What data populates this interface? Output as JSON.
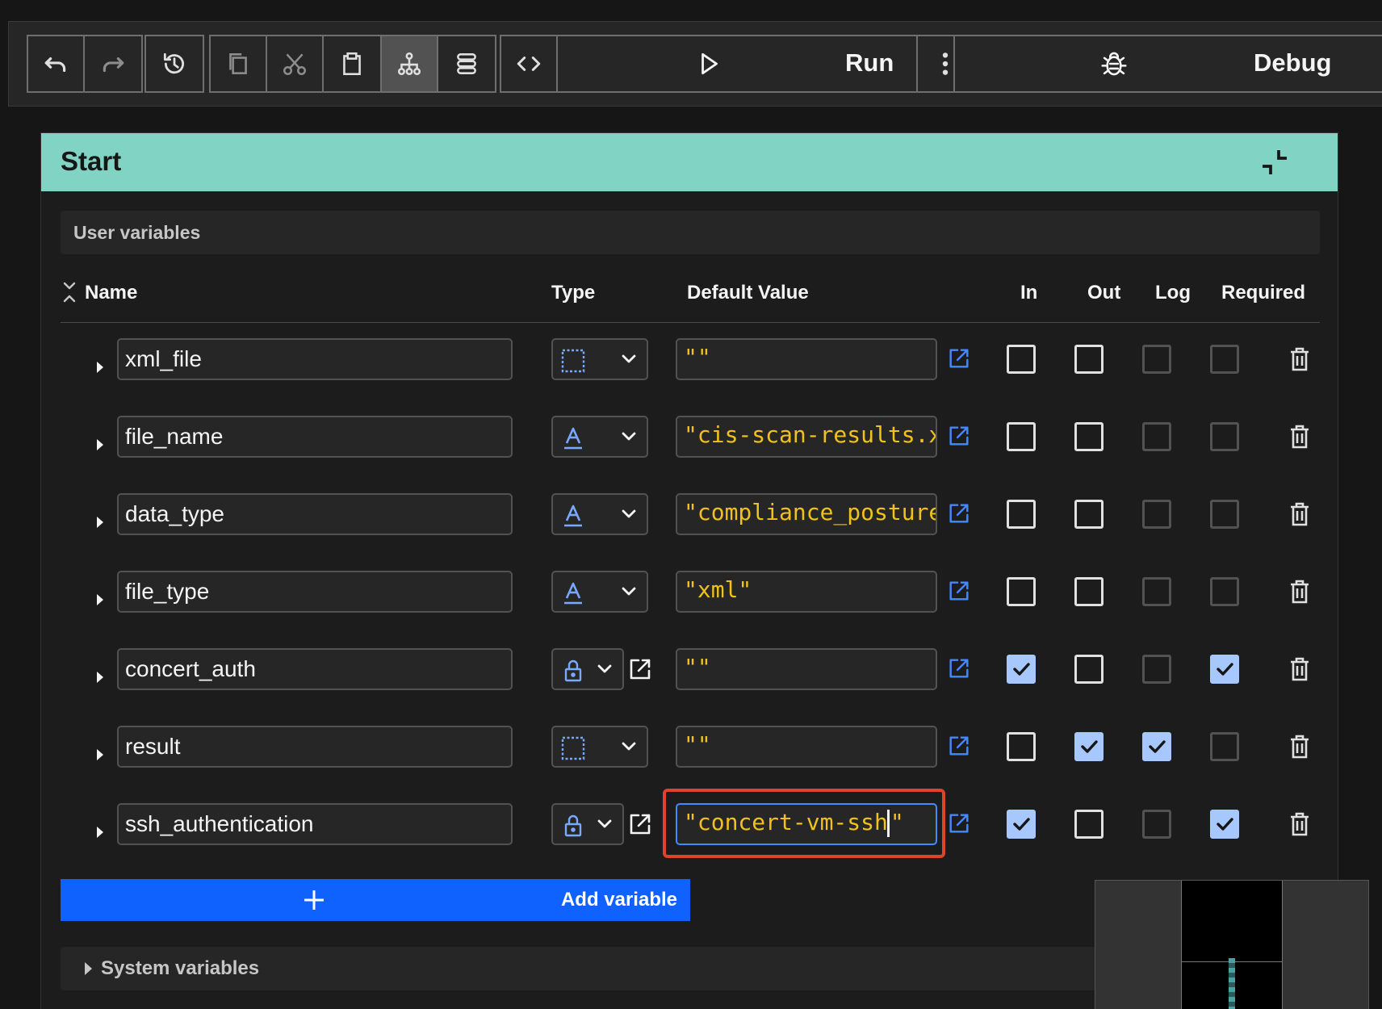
{
  "toolbar": {
    "run_label": "Run",
    "debug_label": "Debug",
    "active_view": "flow-view"
  },
  "start_panel": {
    "title": "Start",
    "user_variables_label": "User variables",
    "columns": {
      "name": "Name",
      "type": "Type",
      "default_value": "Default Value",
      "in": "In",
      "out": "Out",
      "log": "Log",
      "required": "Required"
    },
    "variables": [
      {
        "name": "xml_file",
        "type_icon": "any-type-icon",
        "default_value": "\"\"",
        "in": false,
        "out": false,
        "log": false,
        "required": false
      },
      {
        "name": "file_name",
        "type_icon": "string-type-icon",
        "default_value": "\"cis-scan-results.xml\"",
        "in": false,
        "out": false,
        "log": false,
        "required": false
      },
      {
        "name": "data_type",
        "type_icon": "string-type-icon",
        "default_value": "\"compliance_posture\"",
        "in": false,
        "out": false,
        "log": false,
        "required": false
      },
      {
        "name": "file_type",
        "type_icon": "string-type-icon",
        "default_value": "\"xml\"",
        "in": false,
        "out": false,
        "log": false,
        "required": false
      },
      {
        "name": "concert_auth",
        "type_icon": "lock-type-icon",
        "default_value": "\"\"",
        "in": true,
        "out": false,
        "log": false,
        "required": true
      },
      {
        "name": "result",
        "type_icon": "any-type-icon",
        "default_value": "\"\"",
        "in": false,
        "out": true,
        "log": true,
        "required": false
      },
      {
        "name": "ssh_authentication",
        "type_icon": "lock-type-icon",
        "default_value": "\"concert-vm-ssh\"",
        "in": true,
        "out": false,
        "log": false,
        "required": true
      }
    ],
    "add_variable_label": "Add variable",
    "system_variables_label": "System variables"
  },
  "colors": {
    "header_teal": "#81d3c3",
    "primary_blue": "#0f62fe",
    "value_yellow": "#f1c21b",
    "checkbox_checked": "#a6c8ff",
    "focus_highlight": "#e0432b"
  }
}
